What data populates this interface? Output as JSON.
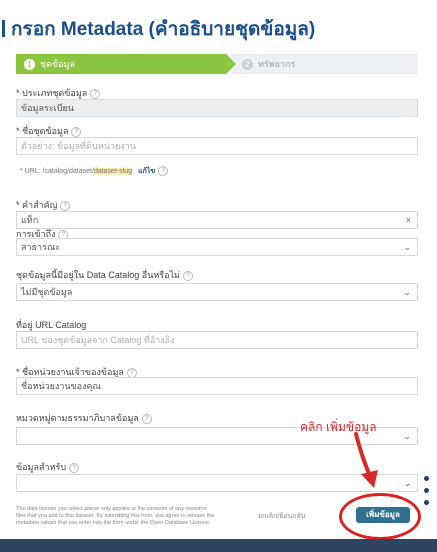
{
  "title": "กรอก Metadata (คำอธิบายชุดข้อมูล)",
  "stepper": {
    "step1": {
      "number": "1",
      "label": "ชุดข้อมูล"
    },
    "step2": {
      "number": "2",
      "label": "ทรัพยากร"
    }
  },
  "fields": {
    "type": {
      "label": "* ประเภทชุดข้อมูล",
      "value": "ข้อมูลระเบียน"
    },
    "name": {
      "label": "* ชื่อชุดข้อมูล",
      "placeholder": "ตัวอย่าง: ข้อมูลที่ดินหน่วยงาน"
    },
    "url_hint": {
      "prefix": "* URL: /catalog/dataset/",
      "highlight": "dataset-slug",
      "action": "แก้ไข"
    },
    "tags": {
      "label": "* คำสำคัญ",
      "value": "แท็ก"
    },
    "license": {
      "label": "การเข้าถึง",
      "value": "สาธารณะ"
    },
    "catalog_flag": {
      "label": "ชุดข้อมูลนี้มีอยู่ใน Data Catalog อื่นหรือไม่",
      "value": "ไม่มีชุดข้อมูล"
    },
    "catalog_url": {
      "label": "ที่อยู่ URL Catalog",
      "placeholder": "URL ของชุดข้อมูลจาก Catalog ที่อ้างอิง"
    },
    "agency": {
      "label": "* ชื่อหน่วยงานเจ้าของข้อมูล",
      "placeholder": "ชื่อหน่วยงานของคุณ"
    },
    "category": {
      "label": "หมวดหมู่ตามธรรมาภิบาลข้อมูล",
      "value": ""
    },
    "data_type": {
      "label": "ข้อมูลสำหรับ",
      "value": ""
    }
  },
  "annotation": "คลิก เพิ่มข้อมูล",
  "footer": {
    "note": "The data license you select above only applies to the contents of any resource files that you add to this dataset. By submitting this form, you agree to release the metadata values that you enter into the form under the Open Database License.",
    "cancel_label": "ยกเลิก/ย้อนกลับ",
    "add_label": "เพิ่มข้อมูล"
  },
  "colors": {
    "title": "#1a4f8b",
    "step_active": "#8cc63f",
    "button": "#2f6f8f",
    "annotation": "#d42a2a"
  }
}
